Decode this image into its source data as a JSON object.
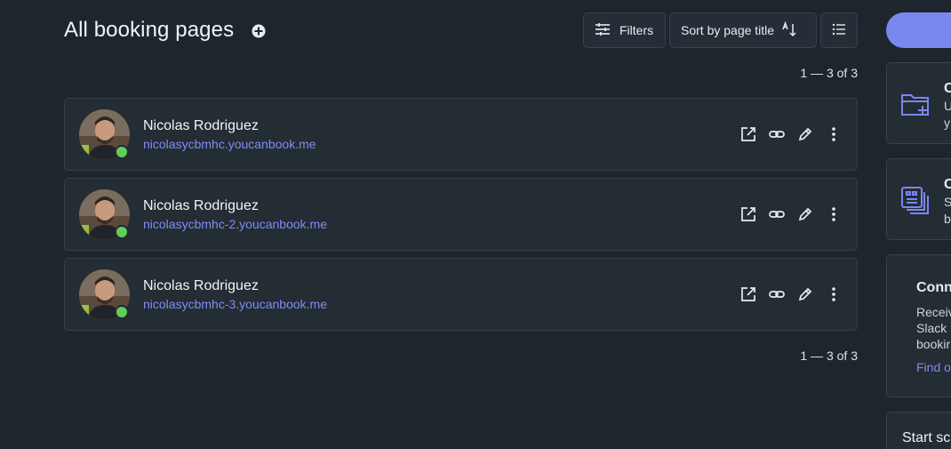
{
  "header": {
    "title": "All booking pages",
    "filters_label": "Filters",
    "sort_label": "Sort by page title"
  },
  "pagination": {
    "top": "1 — 3 of 3",
    "bottom": "1 — 3 of 3"
  },
  "booking_pages": [
    {
      "name": "Nicolas Rodriguez",
      "url": "nicolasycbmhc.youcanbook.me",
      "status": "online"
    },
    {
      "name": "Nicolas Rodriguez",
      "url": "nicolasycbmhc-2.youcanbook.me",
      "status": "online"
    },
    {
      "name": "Nicolas Rodriguez",
      "url": "nicolasycbmhc-3.youcanbook.me",
      "status": "online"
    }
  ],
  "sidebar": {
    "card1": {
      "title": "C",
      "line1": "U",
      "line2": "y"
    },
    "card2": {
      "title": "C",
      "line1": "S",
      "line2": "b"
    },
    "card3": {
      "title": "Conn",
      "line1": "Receiv",
      "line2": "Slack",
      "line3": "bookir",
      "link": "Find o"
    },
    "card4": {
      "title": "Start sc"
    }
  },
  "colors": {
    "background": "#1e252c",
    "card": "#242c34",
    "accent": "#7b87f0",
    "link": "#7f8cf5",
    "status_online": "#5fce5f"
  },
  "icons": [
    "add-circle-icon",
    "filter-sliders-icon",
    "sort-alpha-icon",
    "list-view-icon",
    "external-link-icon",
    "link-icon",
    "edit-pencil-icon",
    "more-vertical-icon",
    "folder-plus-icon",
    "duplicate-pages-icon"
  ]
}
